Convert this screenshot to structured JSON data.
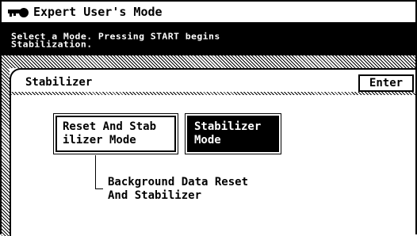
{
  "window": {
    "title": "Expert User's Mode",
    "icon": "key-icon"
  },
  "message": {
    "text": "Select a Mode. Pressing START begins\nStabilization."
  },
  "panel": {
    "title": "Stabilizer",
    "enter_label": "Enter"
  },
  "modes": [
    {
      "label": "Reset And Stab\nilizer Mode",
      "selected": false
    },
    {
      "label": "Stabilizer\nMode",
      "selected": true
    }
  ],
  "description": {
    "text": "Background Data Reset\nAnd Stabilizer"
  },
  "colors": {
    "background": "#ffffff",
    "foreground": "#000000",
    "selected_bg": "#000000",
    "selected_fg": "#ffffff"
  }
}
